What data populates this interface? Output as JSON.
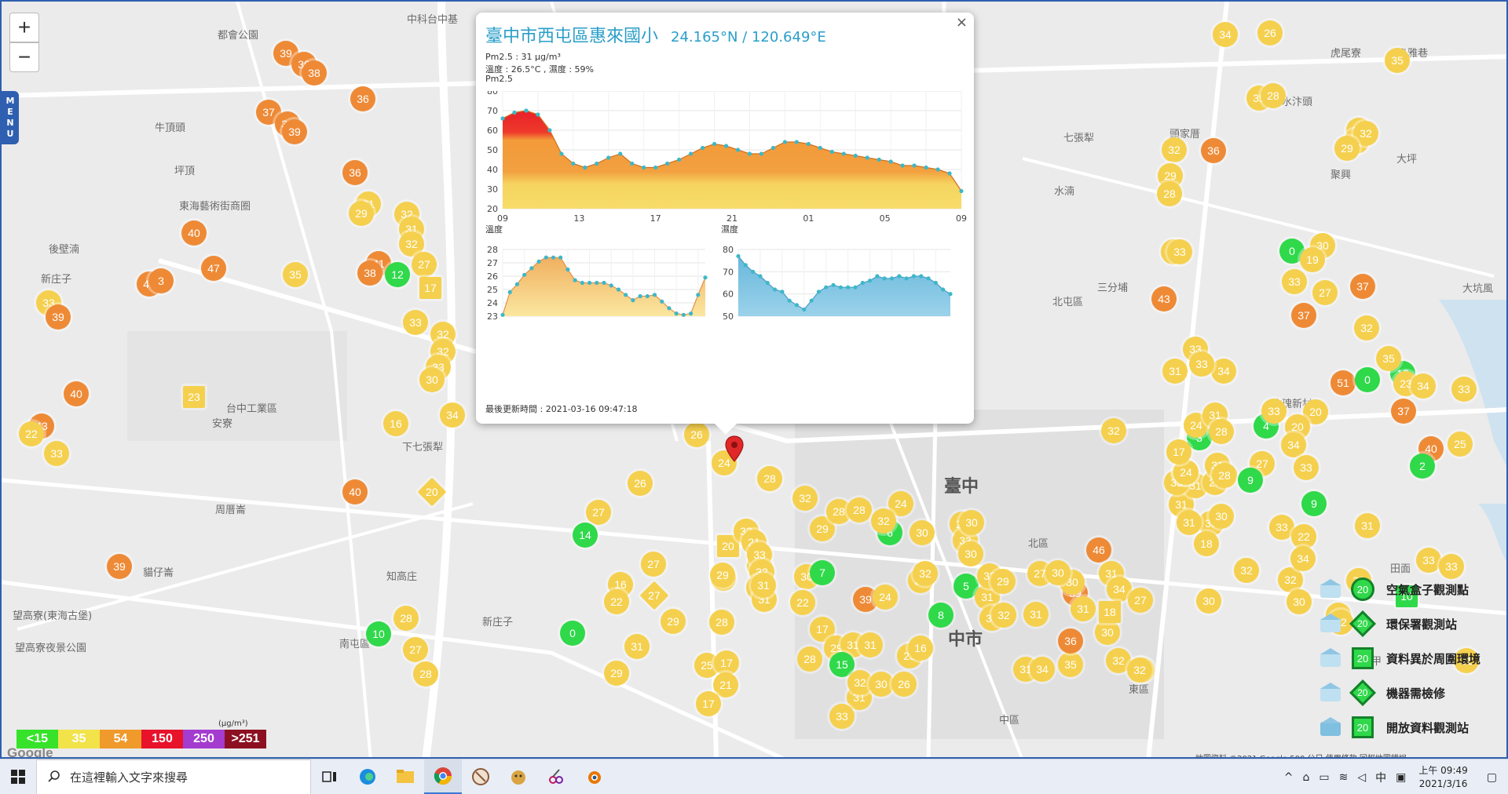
{
  "map": {
    "zoom_in": "+",
    "zoom_out": "−",
    "menu_label": "MENU",
    "labels": [
      {
        "text": "中科台中基",
        "cls": ""
      },
      {
        "text": "都會公園",
        "cls": ""
      },
      {
        "text": "牛頂頭",
        "cls": ""
      },
      {
        "text": "坪頂",
        "cls": ""
      },
      {
        "text": "東海藝術街商圈",
        "cls": ""
      },
      {
        "text": "後壁湳",
        "cls": ""
      },
      {
        "text": "新庄子",
        "cls": ""
      },
      {
        "text": "台中工業區",
        "cls": ""
      },
      {
        "text": "安寮",
        "cls": ""
      },
      {
        "text": "下七張犁",
        "cls": ""
      },
      {
        "text": "周厝崙",
        "cls": ""
      },
      {
        "text": "知高庄",
        "cls": ""
      },
      {
        "text": "新庄子",
        "cls": ""
      },
      {
        "text": "南屯區",
        "cls": ""
      },
      {
        "text": "望高寮(東海古堡)",
        "cls": ""
      },
      {
        "text": "望高寮夜景公園",
        "cls": ""
      },
      {
        "text": "貓仔崙",
        "cls": ""
      },
      {
        "text": "臺中",
        "cls": "big"
      },
      {
        "text": "中市",
        "cls": "big"
      },
      {
        "text": "北區",
        "cls": ""
      },
      {
        "text": "北屯區",
        "cls": ""
      },
      {
        "text": "三分埔",
        "cls": ""
      },
      {
        "text": "水湳",
        "cls": ""
      },
      {
        "text": "七張犁",
        "cls": ""
      },
      {
        "text": "水汴頭",
        "cls": ""
      },
      {
        "text": "頭家厝",
        "cls": ""
      },
      {
        "text": "大坑風",
        "cls": ""
      },
      {
        "text": "東區",
        "cls": ""
      },
      {
        "text": "中區",
        "cls": ""
      },
      {
        "text": "下十甲",
        "cls": ""
      },
      {
        "text": "田面",
        "cls": ""
      },
      {
        "text": "大坪",
        "cls": ""
      },
      {
        "text": "聚興",
        "cls": ""
      },
      {
        "text": "鳥雅巷",
        "cls": ""
      },
      {
        "text": "虎尾寮",
        "cls": ""
      },
      {
        "text": "玫瑰新村",
        "cls": ""
      }
    ],
    "markers": [
      {
        "v": "39",
        "c": "o"
      },
      {
        "v": "36",
        "c": "o"
      },
      {
        "v": "38",
        "c": "o"
      },
      {
        "v": "37",
        "c": "o"
      },
      {
        "v": "39",
        "c": "o"
      },
      {
        "v": "39",
        "c": "o"
      },
      {
        "v": "36",
        "c": "o"
      },
      {
        "v": "36",
        "c": "o"
      },
      {
        "v": "31",
        "c": "y"
      },
      {
        "v": "29",
        "c": "y"
      },
      {
        "v": "32",
        "c": "y"
      },
      {
        "v": "31",
        "c": "y"
      },
      {
        "v": "32",
        "c": "y"
      },
      {
        "v": "40",
        "c": "o"
      },
      {
        "v": "47",
        "c": "o"
      },
      {
        "v": "27",
        "c": "y"
      },
      {
        "v": "41",
        "c": "o"
      },
      {
        "v": "38",
        "c": "o"
      },
      {
        "v": "12",
        "c": "g"
      },
      {
        "v": "35",
        "c": "y"
      },
      {
        "v": "41",
        "c": "o"
      },
      {
        "v": "3",
        "c": "o"
      },
      {
        "v": "33",
        "c": "y"
      },
      {
        "v": "39",
        "c": "o"
      },
      {
        "v": "17",
        "c": "y sq"
      },
      {
        "v": "33",
        "c": "y"
      },
      {
        "v": "32",
        "c": "y"
      },
      {
        "v": "32",
        "c": "y"
      },
      {
        "v": "33",
        "c": "y"
      },
      {
        "v": "30",
        "c": "y"
      },
      {
        "v": "40",
        "c": "o"
      },
      {
        "v": "43",
        "c": "o"
      },
      {
        "v": "22",
        "c": "y"
      },
      {
        "v": "33",
        "c": "y"
      },
      {
        "v": "23",
        "c": "y sq"
      },
      {
        "v": "16",
        "c": "y"
      },
      {
        "v": "34",
        "c": "y"
      },
      {
        "v": "40",
        "c": "o"
      },
      {
        "v": "20",
        "c": "y dm"
      },
      {
        "v": "39",
        "c": "o"
      },
      {
        "v": "26",
        "c": "y"
      },
      {
        "v": "24",
        "c": "y"
      },
      {
        "v": "26",
        "c": "y"
      },
      {
        "v": "27",
        "c": "y"
      },
      {
        "v": "14",
        "c": "g"
      },
      {
        "v": "20",
        "c": "y sq"
      },
      {
        "v": "25",
        "c": "y"
      },
      {
        "v": "27",
        "c": "y"
      },
      {
        "v": "16",
        "c": "y"
      },
      {
        "v": "22",
        "c": "y"
      },
      {
        "v": "27",
        "c": "y dm"
      },
      {
        "v": "29",
        "c": "y"
      },
      {
        "v": "31",
        "c": "y"
      },
      {
        "v": "28",
        "c": "y"
      },
      {
        "v": "10",
        "c": "g"
      },
      {
        "v": "28",
        "c": "y"
      },
      {
        "v": "27",
        "c": "y"
      },
      {
        "v": "28",
        "c": "y"
      },
      {
        "v": "0",
        "c": "g"
      },
      {
        "v": "31",
        "c": "y"
      },
      {
        "v": "29",
        "c": "y"
      },
      {
        "v": "25",
        "c": "y"
      },
      {
        "v": "17",
        "c": "y"
      },
      {
        "v": "21",
        "c": "y"
      },
      {
        "v": "17",
        "c": "y"
      },
      {
        "v": "29",
        "c": "y"
      },
      {
        "v": "28",
        "c": "y"
      },
      {
        "v": "32",
        "c": "y"
      },
      {
        "v": "21",
        "c": "y"
      },
      {
        "v": "33",
        "c": "y"
      },
      {
        "v": "32",
        "c": "y"
      },
      {
        "v": "28",
        "c": "y"
      },
      {
        "v": "31",
        "c": "y"
      },
      {
        "v": "31",
        "c": "y"
      },
      {
        "v": "32",
        "c": "y"
      },
      {
        "v": "30",
        "c": "y"
      },
      {
        "v": "29",
        "c": "y"
      },
      {
        "v": "28",
        "c": "y"
      },
      {
        "v": "7",
        "c": "g"
      },
      {
        "v": "22",
        "c": "y"
      },
      {
        "v": "28",
        "c": "y"
      },
      {
        "v": "24",
        "c": "y"
      },
      {
        "v": "30",
        "c": "y"
      },
      {
        "v": "6",
        "c": "g"
      },
      {
        "v": "28",
        "c": "y"
      },
      {
        "v": "32",
        "c": "y"
      },
      {
        "v": "32",
        "c": "y"
      },
      {
        "v": "39",
        "c": "o"
      },
      {
        "v": "24",
        "c": "y"
      },
      {
        "v": "17",
        "c": "y"
      },
      {
        "v": "29",
        "c": "y"
      },
      {
        "v": "31",
        "c": "y"
      },
      {
        "v": "15",
        "c": "g"
      },
      {
        "v": "31",
        "c": "y"
      },
      {
        "v": "31",
        "c": "y"
      },
      {
        "v": "28",
        "c": "y"
      },
      {
        "v": "32",
        "c": "y"
      },
      {
        "v": "33",
        "c": "y"
      },
      {
        "v": "30",
        "c": "y"
      },
      {
        "v": "25",
        "c": "y"
      },
      {
        "v": "29",
        "c": "y"
      },
      {
        "v": "32",
        "c": "y"
      },
      {
        "v": "5",
        "c": "g"
      },
      {
        "v": "16",
        "c": "y"
      },
      {
        "v": "26",
        "c": "y"
      },
      {
        "v": "30",
        "c": "y"
      },
      {
        "v": "31",
        "c": "y"
      },
      {
        "v": "8",
        "c": "g"
      },
      {
        "v": "31",
        "c": "y"
      },
      {
        "v": "35",
        "c": "y"
      },
      {
        "v": "39",
        "c": "o"
      },
      {
        "v": "36",
        "c": "o"
      },
      {
        "v": "31",
        "c": "y"
      },
      {
        "v": "27",
        "c": "y"
      },
      {
        "v": "32",
        "c": "y"
      },
      {
        "v": "34",
        "c": "y"
      },
      {
        "v": "30",
        "c": "y"
      },
      {
        "v": "32",
        "c": "y"
      },
      {
        "v": "29",
        "c": "y"
      },
      {
        "v": "32",
        "c": "y"
      },
      {
        "v": "30",
        "c": "y"
      },
      {
        "v": "31",
        "c": "y"
      },
      {
        "v": "30",
        "c": "y"
      },
      {
        "v": "32",
        "c": "y"
      },
      {
        "v": "30",
        "c": "y"
      },
      {
        "v": "46",
        "c": "o"
      },
      {
        "v": "31",
        "c": "y"
      },
      {
        "v": "34",
        "c": "y"
      },
      {
        "v": "18",
        "c": "y sq"
      },
      {
        "v": "31",
        "c": "y"
      },
      {
        "v": "27",
        "c": "y"
      },
      {
        "v": "26",
        "c": "y"
      },
      {
        "v": "32",
        "c": "y"
      },
      {
        "v": "30",
        "c": "y"
      },
      {
        "v": "31",
        "c": "y"
      },
      {
        "v": "32",
        "c": "y"
      },
      {
        "v": "30",
        "c": "y"
      },
      {
        "v": "18",
        "c": "y"
      },
      {
        "v": "28",
        "c": "y"
      },
      {
        "v": "31",
        "c": "y"
      },
      {
        "v": "32",
        "c": "y"
      },
      {
        "v": "3",
        "c": "g"
      },
      {
        "v": "28",
        "c": "y"
      },
      {
        "v": "32",
        "c": "y"
      },
      {
        "v": "43",
        "c": "o"
      },
      {
        "v": "31",
        "c": "y"
      },
      {
        "v": "34",
        "c": "y"
      },
      {
        "v": "33",
        "c": "y"
      },
      {
        "v": "30",
        "c": "y"
      },
      {
        "v": "31",
        "c": "y"
      },
      {
        "v": "19",
        "c": "y"
      },
      {
        "v": "24",
        "c": "y"
      },
      {
        "v": "17",
        "c": "y"
      },
      {
        "v": "24",
        "c": "y"
      },
      {
        "v": "31",
        "c": "y"
      },
      {
        "v": "33",
        "c": "y"
      },
      {
        "v": "33",
        "c": "y"
      },
      {
        "v": "4",
        "c": "g"
      },
      {
        "v": "27",
        "c": "y"
      },
      {
        "v": "28",
        "c": "y"
      },
      {
        "v": "9",
        "c": "g"
      },
      {
        "v": "33",
        "c": "y"
      },
      {
        "v": "0",
        "c": "g"
      },
      {
        "v": "30",
        "c": "y"
      },
      {
        "v": "19",
        "c": "y"
      },
      {
        "v": "27",
        "c": "y"
      },
      {
        "v": "33",
        "c": "y"
      },
      {
        "v": "37",
        "c": "o"
      },
      {
        "v": "37",
        "c": "o"
      },
      {
        "v": "12",
        "c": "g"
      },
      {
        "v": "20",
        "c": "y"
      },
      {
        "v": "20",
        "c": "y"
      },
      {
        "v": "34",
        "c": "y"
      },
      {
        "v": "33",
        "c": "y"
      },
      {
        "v": "33",
        "c": "y"
      },
      {
        "v": "51",
        "c": "o"
      },
      {
        "v": "40",
        "c": "o"
      },
      {
        "v": "23",
        "c": "y"
      },
      {
        "v": "35",
        "c": "y"
      },
      {
        "v": "32",
        "c": "y"
      },
      {
        "v": "0",
        "c": "g"
      },
      {
        "v": "37",
        "c": "o"
      },
      {
        "v": "34",
        "c": "y"
      },
      {
        "v": "33",
        "c": "y"
      },
      {
        "v": "25",
        "c": "y"
      },
      {
        "v": "33",
        "c": "y"
      },
      {
        "v": "2",
        "c": "g"
      },
      {
        "v": "31",
        "c": "y"
      },
      {
        "v": "30",
        "c": "y"
      },
      {
        "v": "32",
        "c": "y"
      },
      {
        "v": "10",
        "c": "g sq"
      },
      {
        "v": "33",
        "c": "y"
      },
      {
        "v": "31",
        "c": "y"
      },
      {
        "v": "32",
        "c": "y"
      },
      {
        "v": "33",
        "c": "y"
      },
      {
        "v": "32",
        "c": "y"
      },
      {
        "v": "9",
        "c": "g"
      },
      {
        "v": "22",
        "c": "y"
      },
      {
        "v": "34",
        "c": "y"
      },
      {
        "v": "30",
        "c": "y"
      },
      {
        "v": "26",
        "c": "y"
      },
      {
        "v": "34",
        "c": "y"
      },
      {
        "v": "35",
        "c": "y"
      },
      {
        "v": "28",
        "c": "y"
      },
      {
        "v": "36",
        "c": "o"
      },
      {
        "v": "32",
        "c": "y"
      },
      {
        "v": "29",
        "c": "y"
      },
      {
        "v": "28",
        "c": "y"
      },
      {
        "v": "32",
        "c": "y"
      },
      {
        "v": "35",
        "c": "y"
      },
      {
        "v": "31",
        "c": "y"
      },
      {
        "v": "32",
        "c": "y"
      },
      {
        "v": "29",
        "c": "y"
      }
    ],
    "scale": [
      {
        "label": "<15",
        "color": "#36e32a"
      },
      {
        "label": "35",
        "color": "#f2e34a"
      },
      {
        "label": "54",
        "color": "#f09a2b"
      },
      {
        "label": "150",
        "color": "#e8122a"
      },
      {
        "label": "250",
        "color": "#a43cd0"
      },
      {
        "label": ">251",
        "color": "#8c1022"
      }
    ],
    "scale_unit": "(μg/m³)",
    "google_logo": "Google",
    "attribution": "地圖資料 ©2021 Google   500 公尺         使用條款   回報地圖錯誤",
    "station_legend": [
      {
        "label": "空氣盒子觀測點",
        "icon": "ring",
        "value": "20"
      },
      {
        "label": "環保署觀測站",
        "icon": "dia",
        "value": "20"
      },
      {
        "label": "資料異於周圍環境",
        "icon": "sqr",
        "value": "20"
      },
      {
        "label": "機器需檢修",
        "icon": "dia",
        "value": "20"
      },
      {
        "label": "開放資料觀測站",
        "icon": "sqr",
        "value": "20"
      }
    ]
  },
  "popup": {
    "title": "臺中市西屯區惠來國小",
    "coords": "24.165°N / 120.649°E",
    "close": "×",
    "pm25_line": "Pm2.5 : 31 μg/m³",
    "weather_line": "溫度 : 26.5°C , 濕度 : 59%",
    "pm_chart_label": "Pm2.5",
    "temp_chart_label": "溫度",
    "hum_chart_label": "濕度",
    "updated": "最後更新時間 : 2021-03-16 09:47:18"
  },
  "chart_data": [
    {
      "type": "area",
      "title": "Pm2.5",
      "x": [
        "09",
        "13",
        "17",
        "21",
        "01",
        "05",
        "09"
      ],
      "ylim": [
        20,
        80
      ],
      "yticks": [
        20,
        30,
        40,
        50,
        60,
        70,
        80
      ],
      "values": [
        66,
        69,
        70,
        68,
        60,
        48,
        43,
        41,
        43,
        46,
        48,
        43,
        41,
        41,
        43,
        45,
        48,
        51,
        53,
        52,
        50,
        48,
        48,
        51,
        54,
        54,
        53,
        51,
        49,
        48,
        47,
        46,
        45,
        44,
        42,
        42,
        41,
        40,
        38,
        29
      ]
    },
    {
      "type": "area",
      "title": "溫度",
      "ylim": [
        23,
        28
      ],
      "yticks": [
        23,
        24,
        25,
        26,
        27,
        28
      ],
      "values": [
        23.1,
        24.8,
        25.4,
        26.1,
        26.6,
        27.1,
        27.4,
        27.4,
        27.4,
        26.5,
        25.7,
        25.5,
        25.5,
        25.5,
        25.5,
        25.3,
        25.0,
        24.6,
        24.2,
        24.5,
        24.5,
        24.6,
        24.1,
        23.6,
        23.2,
        23.1,
        23.2,
        24.6,
        25.9
      ]
    },
    {
      "type": "area",
      "title": "濕度",
      "ylim": [
        50,
        80
      ],
      "yticks": [
        50,
        60,
        70,
        80
      ],
      "values": [
        77,
        73,
        70,
        68,
        65,
        62,
        61,
        57,
        55,
        53,
        57,
        61,
        63,
        64,
        63,
        63,
        63,
        65,
        66,
        68,
        67,
        67,
        68,
        67,
        68,
        68,
        67,
        65,
        62,
        60
      ]
    }
  ],
  "taskbar": {
    "search_placeholder": "在這裡輸入文字來搜尋",
    "tray_lang": "中",
    "time": "上午 09:49",
    "date": "2021/3/16"
  }
}
